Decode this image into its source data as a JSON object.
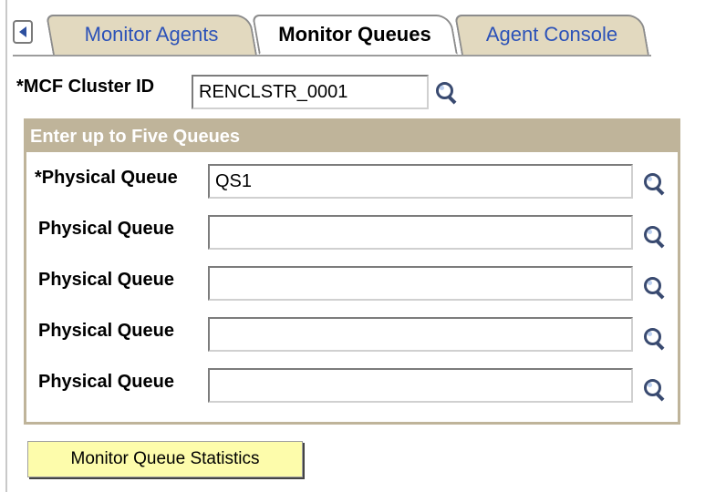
{
  "tabs": [
    {
      "label": "Monitor Agents",
      "active": false
    },
    {
      "label": "Monitor Queues",
      "active": true
    },
    {
      "label": "Agent Console",
      "active": false
    }
  ],
  "cluster": {
    "label": "*MCF Cluster ID",
    "value": "RENCLSTR_0001"
  },
  "queues_group": {
    "title": "Enter up to Five Queues",
    "rows": [
      {
        "label": "*Physical Queue",
        "value": "QS1"
      },
      {
        "label": "Physical Queue",
        "value": ""
      },
      {
        "label": "Physical Queue",
        "value": ""
      },
      {
        "label": "Physical Queue",
        "value": ""
      },
      {
        "label": "Physical Queue",
        "value": ""
      }
    ]
  },
  "actions": {
    "monitor_label": "Monitor Queue Statistics"
  },
  "colors": {
    "tab_inactive_bg": "#e2d9bf",
    "tab_link": "#2c52b8",
    "groupbox_header": "#bfb49a",
    "button_bg": "#fdfcab"
  },
  "icons": {
    "scroll": "scroll-left-icon",
    "lookup": "magnifier-icon"
  }
}
